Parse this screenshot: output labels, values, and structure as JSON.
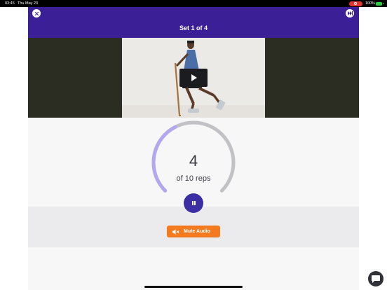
{
  "status_bar": {
    "time": "03:45",
    "date": "Thu May 23",
    "battery_text": "100%",
    "recording_color": "#e3342f",
    "battery_color": "#2ecc40"
  },
  "header": {
    "title": "Set 1 of 4",
    "background_color": "#3a1f96",
    "close_icon": "close-icon",
    "skip_icon": "skip-forward-icon"
  },
  "video": {
    "play_icon": "play-icon"
  },
  "exercise": {
    "rep_count": "4",
    "rep_total_label": "of 10 reps",
    "rep_current": 4,
    "rep_target": 10,
    "progress_color": "#b3a8ee",
    "track_color": "#c2c2c6"
  },
  "controls": {
    "pause_icon": "pause-icon",
    "pause_color": "#3b2fa3",
    "mute_label": "Mute Audio",
    "mute_icon": "speaker-mute-icon",
    "mute_color": "#f47a1f"
  },
  "chat": {
    "icon": "chat-bubble-icon"
  }
}
